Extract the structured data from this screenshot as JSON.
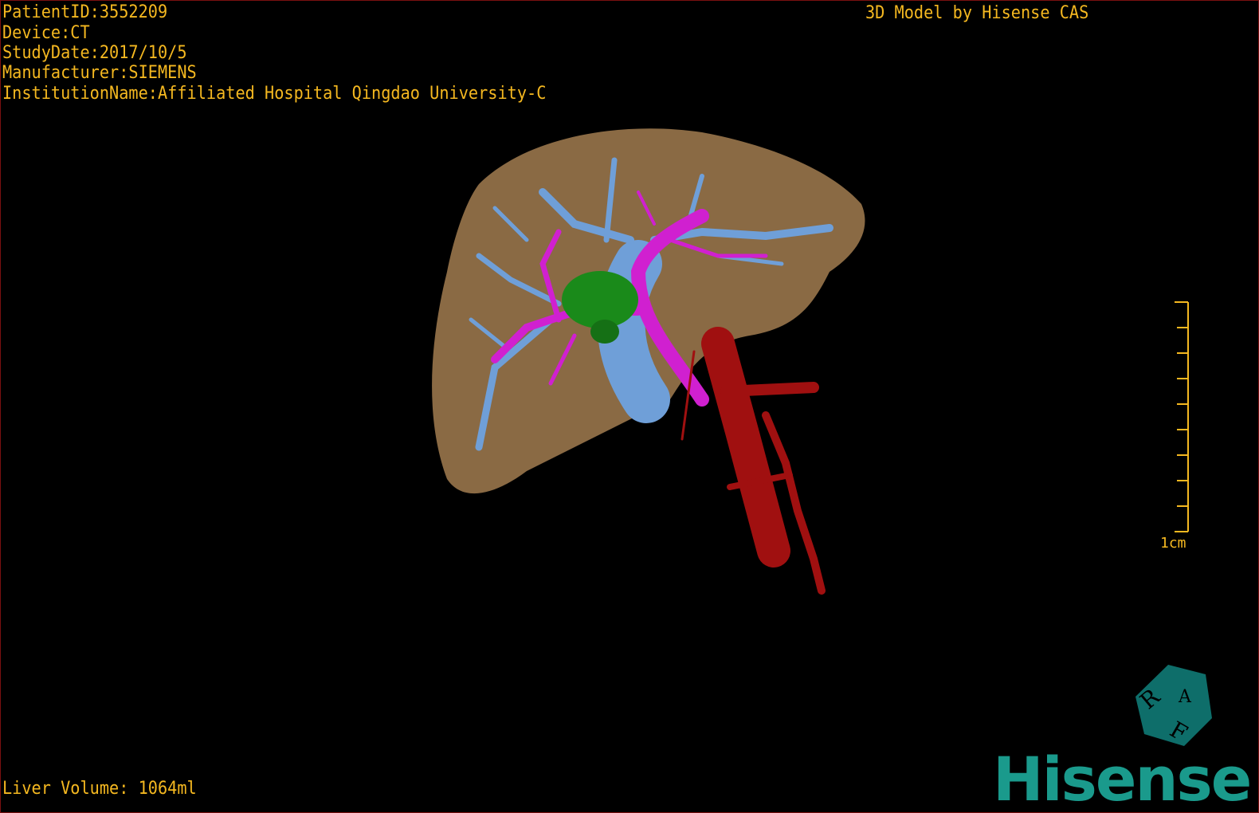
{
  "header": {
    "patient_id": "PatientID:3552209",
    "device": "Device:CT",
    "study_date": "StudyDate:2017/10/5",
    "manufacturer": "Manufacturer:SIEMENS",
    "institution": "InstitutionName:Affiliated Hospital Qingdao University-C",
    "credit": "3D Model by Hisense CAS"
  },
  "footer": {
    "liver_volume": "Liver Volume: 1064ml"
  },
  "scale_bar": {
    "label": "1cm"
  },
  "orientation_cube": {
    "labels": [
      "R",
      "A",
      "F"
    ]
  },
  "logo": {
    "text": "Hisense"
  },
  "colors": {
    "text": "#f5b820",
    "liver": "#8a6a44",
    "hepatic_vein": "#6f9fd8",
    "portal_vein": "#d020d0",
    "tumor": "#1a8a1a",
    "artery": "#a01010",
    "logo": "#1a9a8c"
  }
}
